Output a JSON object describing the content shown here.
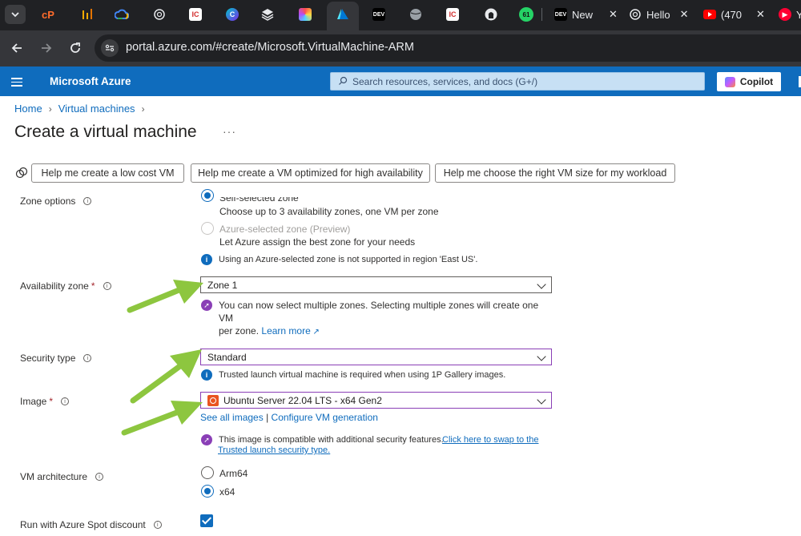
{
  "browser": {
    "tabs": [
      {
        "label": "New"
      },
      {
        "label": "Hello"
      },
      {
        "label": "(470"
      },
      {
        "label": "Y"
      }
    ],
    "dev_badge": "DEV",
    "github_count": "61",
    "url": "portal.azure.com/#create/Microsoft.VirtualMachine-ARM"
  },
  "header": {
    "brand": "Microsoft Azure",
    "search_placeholder": "Search resources, services, and docs (G+/)",
    "copilot_label": "Copilot"
  },
  "breadcrumb": {
    "home": "Home",
    "virtual_machines": "Virtual machines"
  },
  "page": {
    "title": "Create a virtual machine",
    "more": "···"
  },
  "help_buttons": [
    "Help me create a low cost VM",
    "Help me create a VM optimized for high availability",
    "Help me choose the right VM size for my workload"
  ],
  "zone_options": {
    "label": "Zone options",
    "self_selected": {
      "label": "Self-selected zone",
      "desc": "Choose up to 3 availability zones, one VM per zone"
    },
    "azure_selected": {
      "label": "Azure-selected zone (Preview)",
      "desc": "Let Azure assign the best zone for your needs"
    },
    "note": "Using an Azure-selected zone is not supported in region 'East US'."
  },
  "availability_zone": {
    "label": "Availability zone",
    "value": "Zone 1",
    "note": "You can now select multiple zones. Selecting multiple zones will create one VM",
    "note_2": "per zone.",
    "learn_more": "Learn more"
  },
  "security_type": {
    "label": "Security type",
    "value": "Standard",
    "note": "Trusted launch virtual machine is required when using 1P Gallery images."
  },
  "image": {
    "label": "Image",
    "value": "Ubuntu Server 22.04 LTS - x64 Gen2",
    "see_all": "See all images",
    "divider": "|",
    "configure": "Configure VM generation",
    "note": "This image is compatible with additional security features.",
    "swap_link_1": "Click here to swap to the",
    "swap_link_2": "Trusted launch security type."
  },
  "vm_architecture": {
    "label": "VM architecture",
    "options": [
      "Arm64",
      "x64"
    ],
    "selected": "x64"
  },
  "spot": {
    "label": "Run with Azure Spot discount",
    "checked": true
  },
  "colors": {
    "azure_blue": "#0f6cbd",
    "annotation_arrow": "#8dc63f",
    "focus_purple": "#8a3fb6"
  }
}
